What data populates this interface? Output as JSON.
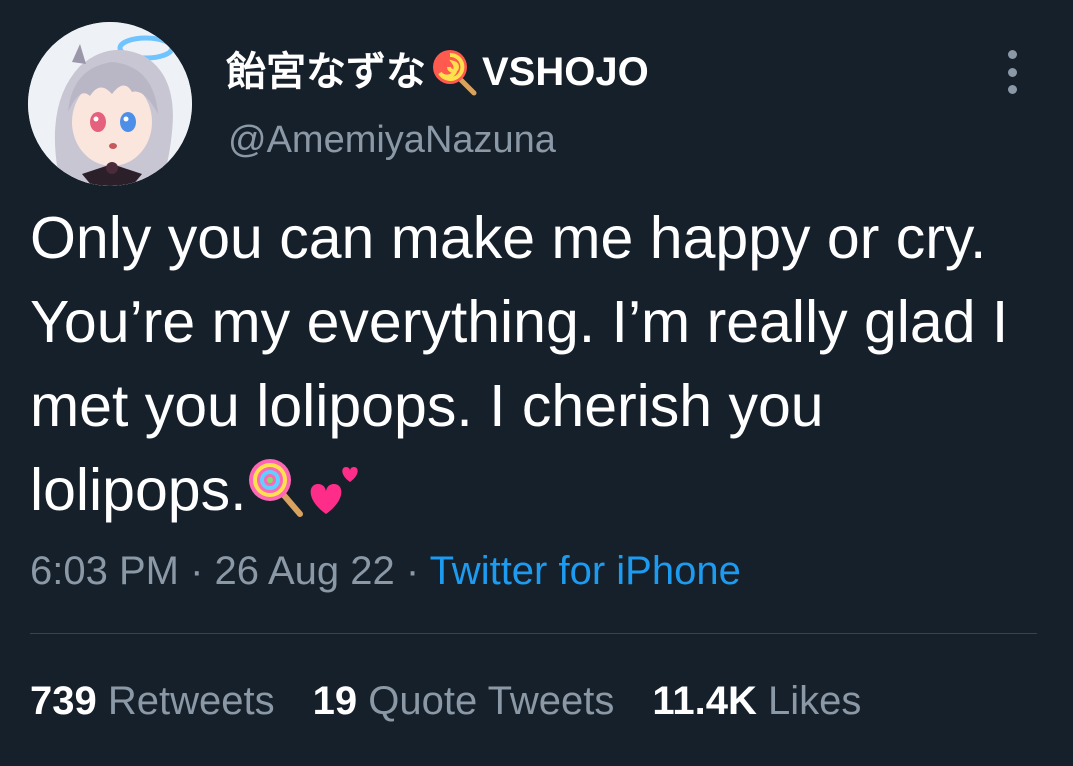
{
  "user": {
    "display_name": "飴宮なずな",
    "display_name_suffix": "VSHOJO",
    "display_name_emoji": "lollipop",
    "handle": "@AmemiyaNazuna",
    "avatar": "anime-girl-avatar"
  },
  "tweet": {
    "text": "Only you can make me happy or cry. You’re my everything. I’m really glad I met you lolipops. I cherish you lolipops.",
    "text_emojis": [
      "lollipop",
      "two-hearts"
    ],
    "time": "6:03 PM",
    "separator": "·",
    "date": "26 Aug 22",
    "source": "Twitter for iPhone"
  },
  "stats": {
    "retweets_count": "739",
    "retweets_label": "Retweets",
    "quotes_count": "19",
    "quotes_label": "Quote Tweets",
    "likes_count": "11.4K",
    "likes_label": "Likes"
  },
  "colors": {
    "background": "#15202b",
    "primary_text": "#ffffff",
    "secondary_text": "#8b98a5",
    "link": "#1d9bf0",
    "divider": "#38444d"
  },
  "icons": {
    "more": "more-vertical-icon"
  }
}
